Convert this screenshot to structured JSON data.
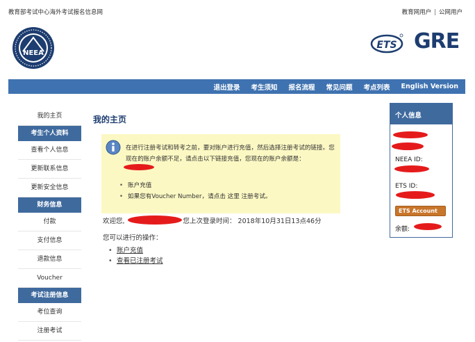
{
  "top": {
    "site_name": "教育部考试中心海外考试报名信息网",
    "links": [
      "教育网用户",
      "公网用户"
    ]
  },
  "logos": {
    "neea_text": "NEEA",
    "ets_text": "ETS",
    "gre_text": "GRE"
  },
  "nav": {
    "items": [
      "退出登录",
      "考生须知",
      "报名流程",
      "常见问题",
      "考点列表",
      "English Version"
    ]
  },
  "sidebar": {
    "items": [
      {
        "type": "item",
        "label": "我的主页"
      },
      {
        "type": "header",
        "label": "考生个人资料"
      },
      {
        "type": "item",
        "label": "查看个人信息"
      },
      {
        "type": "item",
        "label": "更新联系信息"
      },
      {
        "type": "item",
        "label": "更新安全信息"
      },
      {
        "type": "header",
        "label": "财务信息"
      },
      {
        "type": "item",
        "label": "付款"
      },
      {
        "type": "item",
        "label": "支付信息"
      },
      {
        "type": "item",
        "label": "退款信息"
      },
      {
        "type": "item",
        "label": "Voucher"
      },
      {
        "type": "header",
        "label": "考试注册信息"
      },
      {
        "type": "item",
        "label": "考位查询"
      },
      {
        "type": "item",
        "label": "注册考试"
      }
    ]
  },
  "main": {
    "title": "我的主页",
    "notice": {
      "text": "在进行注册考试和转考之前，要对账户进行充值，然后选择注册考试的链接。您现在的账户余额不足，请点击以下链接充值，您现在的账户余额是：",
      "items": [
        "账户充值",
        "如果您有Voucher Number，请点击 这里 注册考试。"
      ]
    },
    "welcome_prefix": "欢迎您,",
    "last_login": "您上次登录时间：  2018年10月31日13点46分",
    "ops_label": "您可以进行的操作：",
    "ops": [
      "账户充值",
      "查看已注册考试"
    ]
  },
  "info_panel": {
    "title": "个人信息",
    "neea_id_label": "NEEA ID:",
    "ets_id_label": "ETS ID:",
    "ets_button": "ETS Account",
    "balance_label": "余额:"
  },
  "colors": {
    "nav_blue": "#3f72b0",
    "header_blue": "#3f6a9e",
    "notice_yellow": "#fbf8c3",
    "redaction_red": "#e51b1b",
    "ets_orange": "#c8762b"
  }
}
